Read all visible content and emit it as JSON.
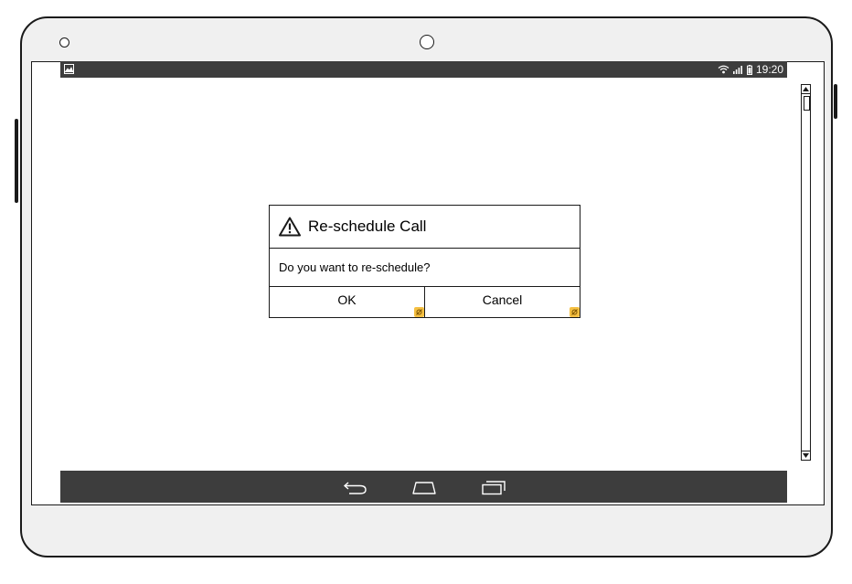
{
  "status_bar": {
    "time": "19:20",
    "icons": [
      "image-notification-icon",
      "wifi-icon",
      "signal-icon",
      "battery-icon"
    ]
  },
  "dialog": {
    "icon": "warning-icon",
    "title": "Re-schedule Call",
    "message": "Do you want to re-schedule?",
    "buttons": {
      "ok_label": "OK",
      "cancel_label": "Cancel"
    },
    "link_badge_color": "#f5c042"
  },
  "nav_bar": {
    "icons": [
      "back-icon",
      "home-icon",
      "recent-apps-icon"
    ]
  },
  "colors": {
    "bars": "#3d3d3d",
    "device_body": "#f0f0f0"
  }
}
